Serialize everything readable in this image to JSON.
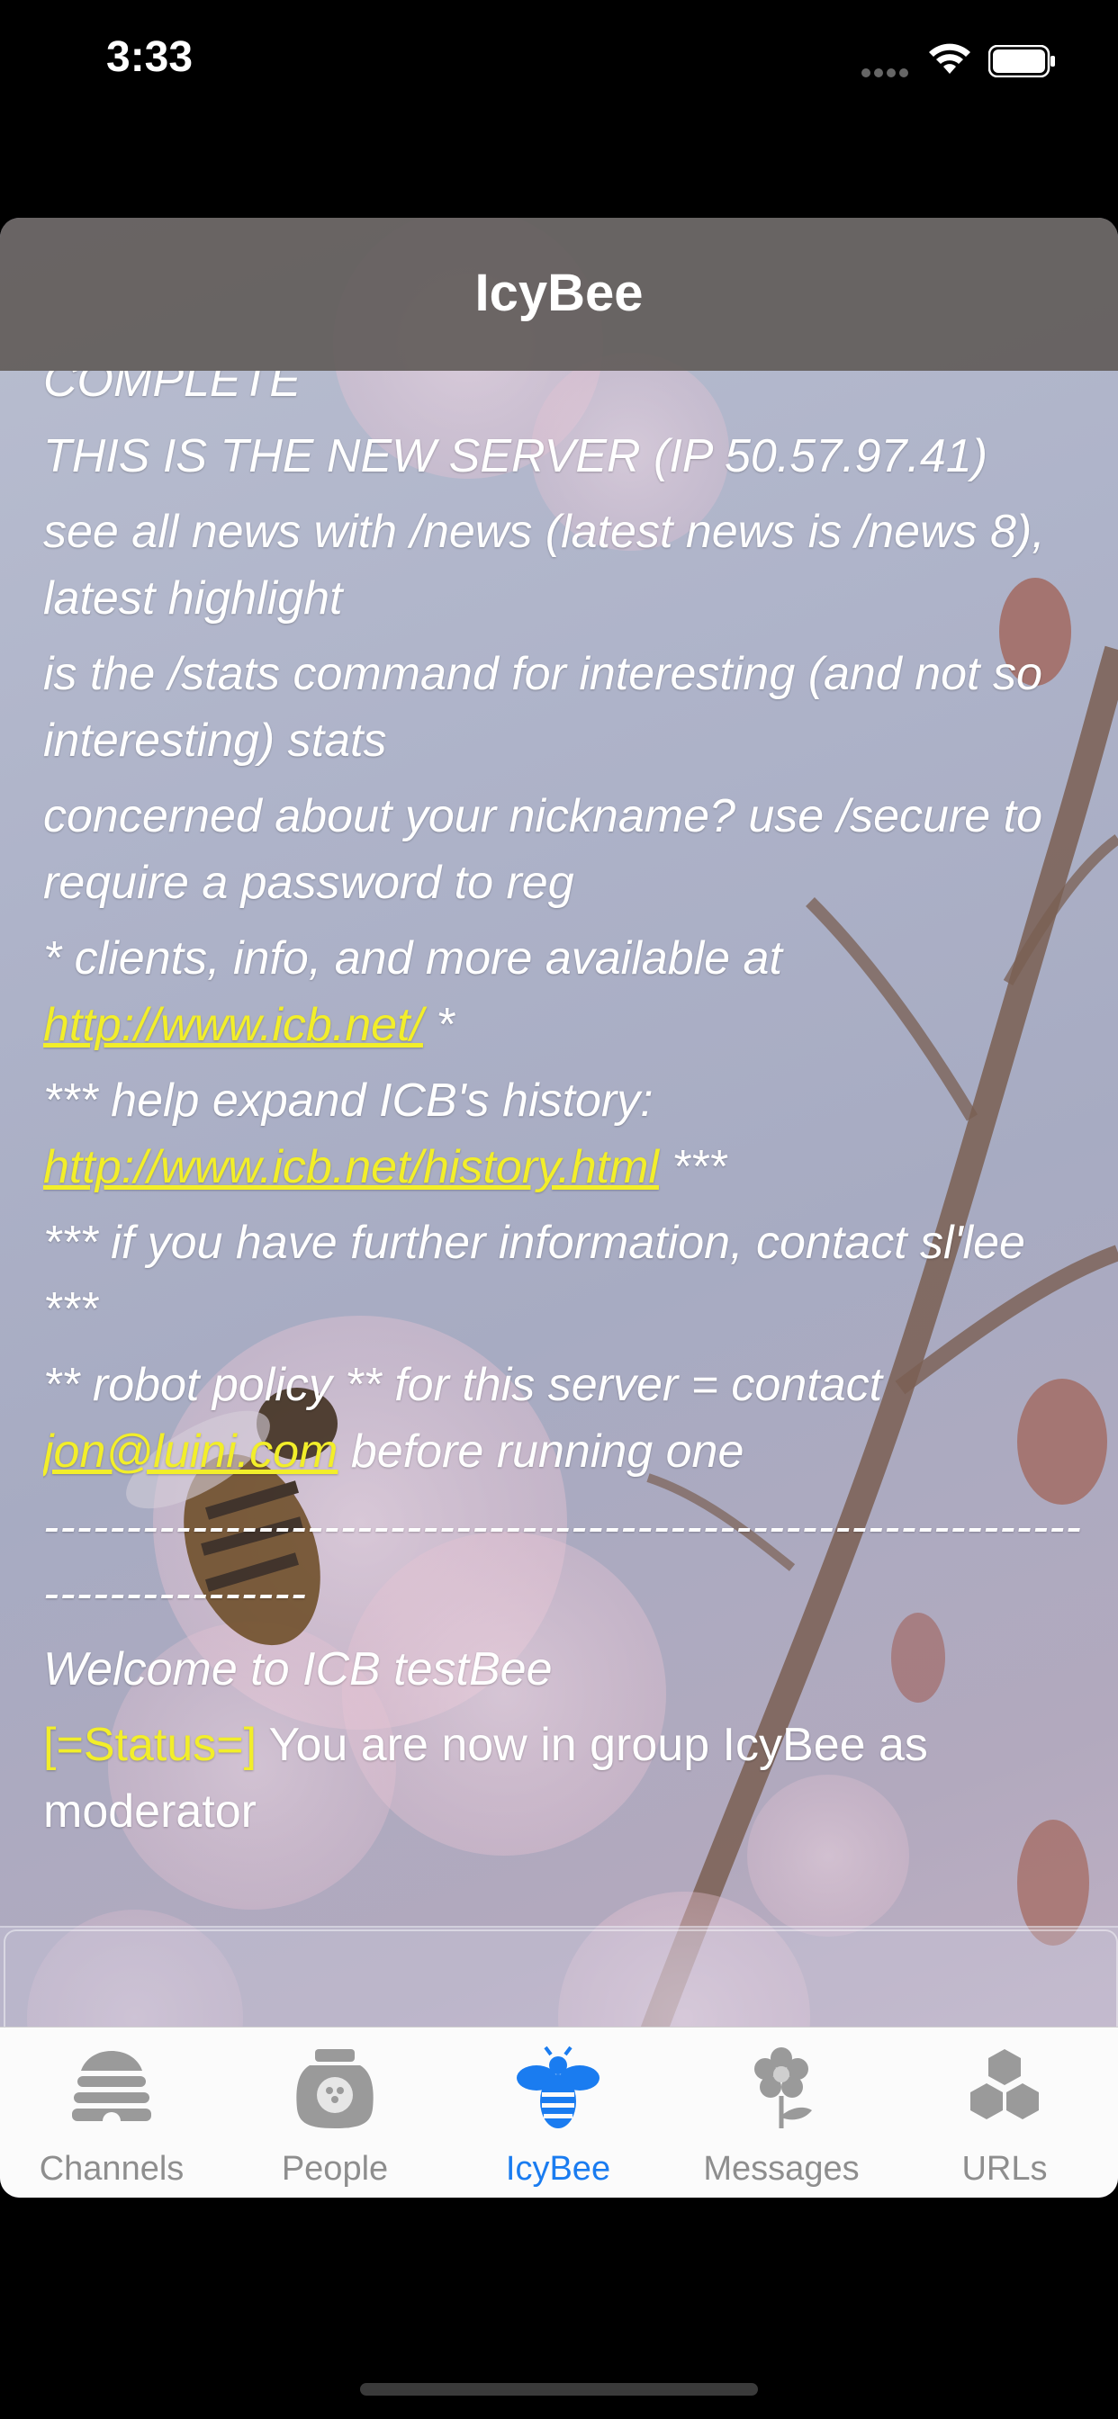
{
  "status_bar": {
    "time": "3:33"
  },
  "nav": {
    "title": "IcyBee"
  },
  "messages": {
    "complete": "COMPLETE",
    "new_server": "THIS IS THE NEW SERVER (IP 50.57.97.41)",
    "news": "see all news with /news (latest news is /news 8), latest highlight",
    "stats": "is the /stats command for interesting (and not so interesting) stats",
    "secure": "concerned about your nickname? use /secure to require a password to reg",
    "clients_prefix": "* clients, info, and more available at ",
    "clients_link": "http://www.icb.net/",
    "clients_suffix": " *",
    "history_prefix": "*** help expand ICB's history: ",
    "history_link": "http://www.icb.net/history.html",
    "history_suffix": " ***",
    "contact": "*** if you have further information, contact sl'lee ***",
    "robot_prefix": "** robot policy ** for this server = contact ",
    "robot_link": "jon@luini.com",
    "robot_suffix": " before running one",
    "dashes": "-------------------------------------------------------------------------------",
    "welcome": "Welcome to ICB testBee",
    "status_tag": "[=Status=]",
    "status_text": " You are now in group IcyBee as moderator"
  },
  "tabs": [
    {
      "label": "Channels",
      "icon": "beehive-icon",
      "active": false
    },
    {
      "label": "People",
      "icon": "jar-icon",
      "active": false
    },
    {
      "label": "IcyBee",
      "icon": "bee-icon",
      "active": true
    },
    {
      "label": "Messages",
      "icon": "flower-icon",
      "active": false
    },
    {
      "label": "URLs",
      "icon": "honeycomb-icon",
      "active": false
    }
  ],
  "colors": {
    "link": "#f2ee2a",
    "tab_active": "#1a7cf0",
    "tab_inactive": "#8e8e8e",
    "nav_bg": "#625c5a"
  }
}
